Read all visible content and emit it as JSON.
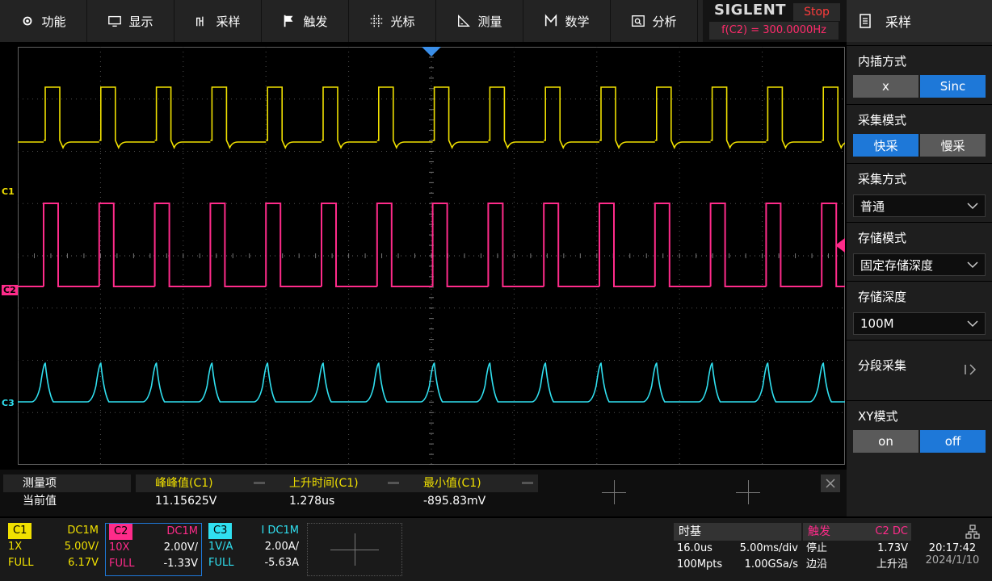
{
  "menu": [
    {
      "label": "功能",
      "icon": "gear-icon"
    },
    {
      "label": "显示",
      "icon": "monitor-icon"
    },
    {
      "label": "采样",
      "icon": "sample-icon"
    },
    {
      "label": "触发",
      "icon": "flag-icon"
    },
    {
      "label": "光标",
      "icon": "cursor-grid-icon"
    },
    {
      "label": "测量",
      "icon": "measure-icon"
    },
    {
      "label": "数学",
      "icon": "math-icon"
    },
    {
      "label": "分析",
      "icon": "analysis-icon"
    }
  ],
  "brand": {
    "logo": "SIGLENT",
    "run_state": "Stop",
    "frequency": "f(C2) = 300.0000Hz"
  },
  "panel": {
    "title": "采样",
    "interpolation": {
      "label": "内插方式",
      "options": [
        "x",
        "Sinc"
      ],
      "selected": "Sinc"
    },
    "acq_mode": {
      "label": "采集模式",
      "options": [
        "快采",
        "慢采"
      ],
      "selected": "快采"
    },
    "acq_method": {
      "label": "采集方式",
      "value": "普通"
    },
    "mem_mode": {
      "label": "存储模式",
      "value": "固定存储深度"
    },
    "mem_depth": {
      "label": "存储深度",
      "value": "100M"
    },
    "segment": {
      "label": "分段采集"
    },
    "xy": {
      "label": "XY模式",
      "options": [
        "on",
        "off"
      ],
      "selected": "off"
    }
  },
  "screen": {
    "markers": {
      "c1": "C1",
      "c2": "C2",
      "c3": "C3"
    },
    "colors": {
      "c1": "#f0e000",
      "c2": "#ff2b8a",
      "c3": "#30e0f0",
      "grid": "#505050"
    }
  },
  "measure": {
    "header": "测量项",
    "row_label": "当前值",
    "items": [
      {
        "name": "峰峰值(C1)",
        "value": "11.15625V"
      },
      {
        "name": "上升时间(C1)",
        "value": "1.278us"
      },
      {
        "name": "最小值(C1)",
        "value": "-895.83mV"
      }
    ]
  },
  "channels": [
    {
      "name": "C1",
      "coupling": "DC1M",
      "probe": "1X",
      "scale": "5.00V/",
      "bw": "FULL",
      "offset": "6.17V"
    },
    {
      "name": "C2",
      "coupling": "DC1M",
      "probe": "10X",
      "scale": "2.00V/",
      "bw": "FULL",
      "offset": "-1.33V"
    },
    {
      "name": "C3",
      "coupling": "I DC1M",
      "probe": "1V/A",
      "scale": "2.00A/",
      "bw": "FULL",
      "offset": "-5.63A"
    }
  ],
  "timebase": {
    "title": "时基",
    "delay": "16.0us",
    "scale": "5.00ms/div",
    "depth": "100Mpts",
    "rate": "1.00GSa/s"
  },
  "trigger": {
    "title": "触发",
    "source": "C2 DC",
    "state": "停止",
    "level": "1.73V",
    "type": "边沿",
    "slope": "上升沿"
  },
  "clock": {
    "time": "20:17:42",
    "date": "2024/1/10"
  }
}
